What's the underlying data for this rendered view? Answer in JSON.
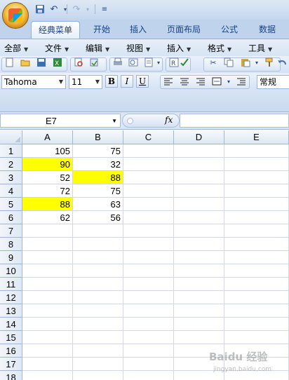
{
  "ribbon": {
    "tabs": [
      {
        "label": "经典菜单",
        "active": true
      },
      {
        "label": "开始"
      },
      {
        "label": "插入"
      },
      {
        "label": "页面布局"
      },
      {
        "label": "公式"
      },
      {
        "label": "数据"
      }
    ]
  },
  "menubar": {
    "items": [
      "全部",
      "文件",
      "编辑",
      "视图",
      "插入",
      "格式",
      "工具"
    ]
  },
  "format_toolbar": {
    "font_name": "Tahoma",
    "font_size": "11",
    "bold": "B",
    "italic": "I",
    "underline": "U",
    "number_format": "常规"
  },
  "formula_bar": {
    "name_box": "E7",
    "fx": "fx",
    "value": ""
  },
  "sheet": {
    "columns": [
      "A",
      "B",
      "C",
      "D",
      "E"
    ],
    "rows": [
      [
        "105",
        "75"
      ],
      [
        "90",
        "32"
      ],
      [
        "52",
        "88"
      ],
      [
        "72",
        "75"
      ],
      [
        "88",
        "63"
      ],
      [
        "62",
        "56"
      ],
      [
        "",
        ""
      ],
      [
        "",
        ""
      ],
      [
        "",
        ""
      ],
      [
        "",
        ""
      ],
      [
        "",
        ""
      ],
      [
        "",
        ""
      ],
      [
        "",
        ""
      ],
      [
        "",
        ""
      ],
      [
        "",
        ""
      ],
      [
        "",
        ""
      ],
      [
        "",
        ""
      ],
      [
        "",
        ""
      ]
    ],
    "row_numbers": [
      "1",
      "2",
      "3",
      "4",
      "5",
      "6",
      "7",
      "8",
      "9",
      "10",
      "11",
      "12",
      "13",
      "14",
      "15",
      "16",
      "17",
      "18"
    ],
    "highlight_color": "#ffff00",
    "highlighted_cells": [
      "A2",
      "B3",
      "A5"
    ]
  },
  "watermark": {
    "text": "Baidu 经验",
    "sub": "jingyan.baidu.com"
  }
}
